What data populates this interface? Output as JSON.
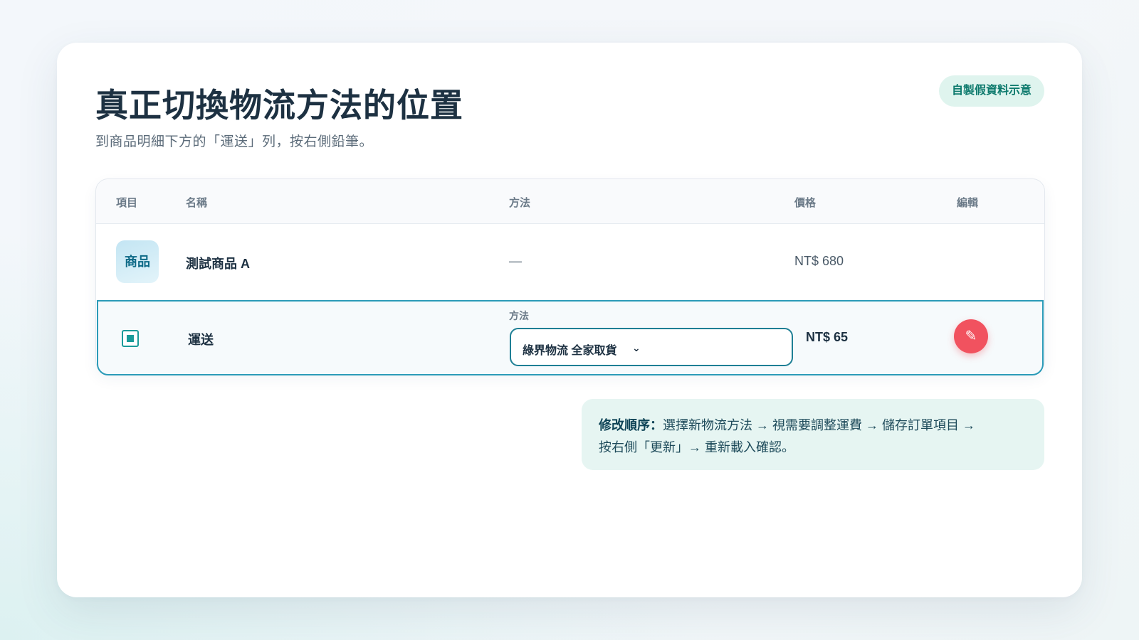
{
  "page": {
    "title": "真正切換物流方法的位置",
    "subtitle": "到商品明細下方的「運送」列，按右側鉛筆。",
    "badge": "自製假資料示意"
  },
  "table": {
    "headers": {
      "item": "項目",
      "name": "名稱",
      "method": "方法",
      "price": "價格",
      "edit": "編輯"
    },
    "product_row": {
      "item_chip": "商品",
      "name": "測試商品 A",
      "method": "—",
      "price": "NT$ 680"
    },
    "shipping_row": {
      "checkbox_icon": "checkbox-icon",
      "name": "運送",
      "method_label": "方法",
      "method_value": "綠界物流 全家取貨",
      "chevron": "⌄",
      "price": "NT$ 65",
      "edit_icon": "✎"
    }
  },
  "note": {
    "label": "修改順序：",
    "line1": "選擇新物流方法 → 視需要調整運費 → 儲存訂單項目 →",
    "line2": "按右側「更新」→ 重新載入確認。"
  },
  "colors": {
    "accent": "#2b9bb8",
    "edit_button": "#f1525f",
    "badge_bg": "#dff4ee",
    "note_bg": "#e6f5f2"
  }
}
